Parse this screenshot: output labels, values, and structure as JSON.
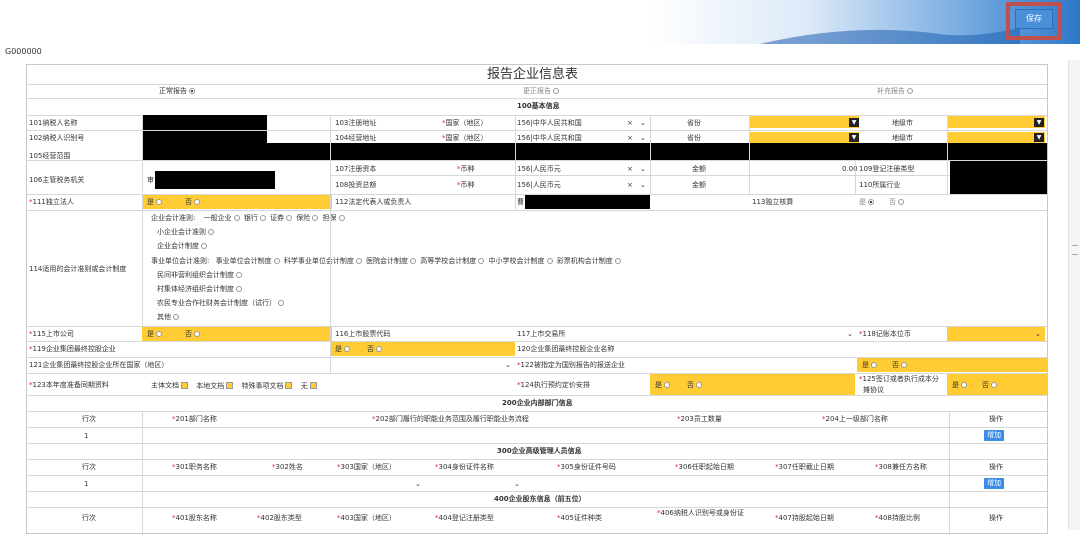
{
  "header": {
    "save_label": "保存"
  },
  "code": "G000000",
  "title": "报告企业信息表",
  "report_types": [
    "正常报告",
    "更正报告",
    "补充报告"
  ],
  "sections": {
    "s100": "100基本信息",
    "s200": "200企业内部部门信息",
    "s300": "300企业高级管理人员信息",
    "s400": "400企业股东信息（前五位）"
  },
  "basic": {
    "f101": "101纳税人名称",
    "f102": "102纳税人识别号",
    "f103": "103注册地址",
    "f104": "104经营地址",
    "f105": "105经营范围",
    "f106": "106主管税务机关",
    "f107": "107注册资本",
    "f108": "108投资总额",
    "f109": "109登记注册类型",
    "f110": "110所属行业",
    "f111": "111独立法人",
    "f112": "112法定代表人或负责人",
    "f113": "113独立核算",
    "country_label": "国家（地区）",
    "country_value": "156|中华人民共和国",
    "province": "省份",
    "city": "地级市",
    "currency_label": "币种",
    "currency_value": "156|人民币元",
    "amount": "金额",
    "amount_value": "0.00",
    "yes": "是",
    "no": "否",
    "x": "×"
  },
  "acct": {
    "f114": "114适用的会计准则或会计制度",
    "l1_label": "企业会计准则:",
    "l1_opts": [
      "一般企业",
      "银行",
      "证券",
      "保险",
      "担保"
    ],
    "small": "小企业会计准则",
    "enterprise": "企业会计制度",
    "l4_label": "事业单位会计准则:",
    "l4_opts": [
      "事业单位会计制度",
      "科学事业单位会计制度",
      "医院会计制度",
      "高等学校会计制度",
      "中小学校会计制度",
      "彩票机构会计制度"
    ],
    "npo": "民间非营利组织会计制度",
    "village": "村集体经济组织会计制度",
    "coop": "农民专业合作社财务会计制度（试行）",
    "other": "其他"
  },
  "listed": {
    "f115": "115上市公司",
    "f116": "116上市股票代码",
    "f117": "117上市交易所",
    "f118": "118记账本位币",
    "f119": "119企业集团最终控股企业",
    "f120": "120企业集团最终控股企业名称",
    "f121": "121企业集团最终控股企业所在国家（地区）",
    "f122": "122被指定为国别报告的报送企业",
    "f123": "123本年度准备同期资料",
    "f123_opts": [
      "主体文档",
      "本地文档",
      "特殊事项文档",
      "无"
    ],
    "f124": "124执行预约定价安排",
    "f125_l1": "125签订或者执行成本分",
    "f125_l2": "摊协议"
  },
  "dept": {
    "h_row": "行次",
    "h201": "201部门名称",
    "h202": "202部门履行的职能业务范围及履行职能业务流程",
    "h203": "203员工数量",
    "h204": "204上一级部门名称",
    "h_op": "操作",
    "row": "1",
    "add": "增加"
  },
  "mgr": {
    "h_row": "行次",
    "h301": "301职务名称",
    "h302": "302姓名",
    "h303": "303国家（地区）",
    "h304": "304身份证件名称",
    "h305": "305身份证件号码",
    "h306": "306任职起始日期",
    "h307": "307任职截止日期",
    "h308": "308兼任方名称",
    "h_op": "操作",
    "row": "1",
    "add": "增加"
  },
  "sh": {
    "h_row": "行次",
    "h401": "401股东名称",
    "h402": "402股东类型",
    "h403": "403国家（地区）",
    "h404": "404登记注册类型",
    "h405": "405证件种类",
    "h406_l1": "406纳税人识别号或身份证",
    "h407": "407持股起始日期",
    "h408": "408持股比例",
    "h_op": "操作"
  },
  "colors": {
    "required": "#e02020",
    "highlight": "#ffcc33",
    "accent": "#3a8ee6",
    "save_outline": "#c0504d"
  }
}
